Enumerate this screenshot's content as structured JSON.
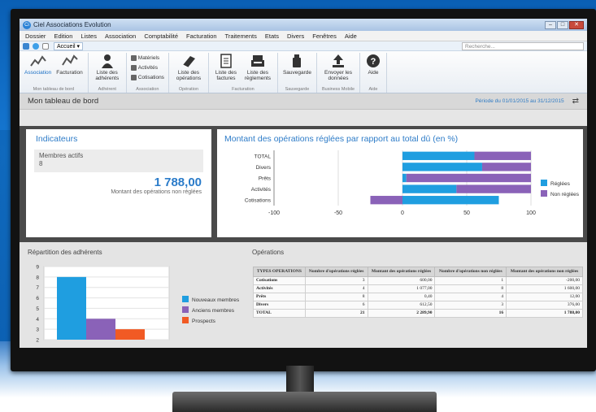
{
  "window": {
    "title": "Ciel Associations Evolution",
    "logo_text": "Ci"
  },
  "menu": [
    "Dossier",
    "Edition",
    "Listes",
    "Association",
    "Comptabilité",
    "Facturation",
    "Traitements",
    "Etats",
    "Divers",
    "Fenêtres",
    "Aide"
  ],
  "quickbar": {
    "tab_label": "Accueil",
    "search_placeholder": "Recherche..."
  },
  "ribbon": {
    "groups": [
      {
        "label": "Mon tableau de bord",
        "buttons": [
          "Association",
          "Facturation"
        ]
      },
      {
        "label": "Adhérent",
        "buttons": [
          "Liste des adhérents"
        ]
      },
      {
        "label": "Association",
        "small_items": [
          "Matériels",
          "Activités",
          "Cotisations"
        ]
      },
      {
        "label": "Opération",
        "buttons": [
          "Liste des opérations"
        ]
      },
      {
        "label": "Facturation",
        "buttons": [
          "Liste des factures",
          "Liste des règlements"
        ]
      },
      {
        "label": "Sauvegarde",
        "buttons": [
          "Sauvegarde"
        ]
      },
      {
        "label": "Business Mobile",
        "buttons": [
          "Envoyer les données"
        ]
      },
      {
        "label": "Aide",
        "buttons": [
          "Aide"
        ]
      }
    ]
  },
  "page": {
    "title": "Mon tableau de bord",
    "period": "Période du 01/01/2015 au 31/12/2015"
  },
  "indicators": {
    "title": "Indicateurs",
    "members_label": "Membres actifs",
    "members_value": "8",
    "amount": "1 788,00",
    "amount_label": "Montant des opérations non réglées"
  },
  "chart_data": [
    {
      "type": "bar",
      "orientation": "horizontal",
      "stacked": true,
      "title": "Montant des opérations réglées par rapport au total dû (en %)",
      "categories": [
        "TOTAL",
        "Divers",
        "Prêts",
        "Activités",
        "Cotisations"
      ],
      "series": [
        {
          "name": "Réglées",
          "color": "#1f9ee0",
          "values": [
            56,
            62,
            3,
            42,
            75
          ]
        },
        {
          "name": "Non réglées",
          "color": "#8a62b8",
          "values": [
            44,
            38,
            97,
            58,
            -25
          ]
        }
      ],
      "xlim": [
        -100,
        100
      ],
      "xticks": [
        "-100",
        "-50",
        "0",
        "50",
        "100"
      ],
      "legend": "right",
      "grid": true
    },
    {
      "type": "bar",
      "title": "Répartition des adhérents",
      "categories": [
        ""
      ],
      "series": [
        {
          "name": "Nouveaux membres",
          "color": "#1f9ee0",
          "values": [
            8
          ]
        },
        {
          "name": "Anciens membres",
          "color": "#8a62b8",
          "values": [
            4
          ]
        },
        {
          "name": "Prospects",
          "color": "#f15a24",
          "values": [
            3
          ]
        }
      ],
      "ylim": [
        2,
        9
      ],
      "yticks": [
        "2",
        "3",
        "4",
        "5",
        "6",
        "7",
        "8",
        "9"
      ],
      "legend": "right",
      "grid": true
    }
  ],
  "operations": {
    "title": "Opérations",
    "headers": [
      "TYPES OPERATIONS",
      "Nombre d'opérations réglées",
      "Montant des opérations réglées",
      "Nombre d'opérations non réglées",
      "Montant des opérations non réglées"
    ],
    "rows": [
      [
        "Cotisations",
        "3",
        "600,00",
        "1",
        "-200,00"
      ],
      [
        "Activités",
        "4",
        "1 077,00",
        "8",
        "1 600,00"
      ],
      [
        "Prêts",
        "8",
        "0,40",
        "4",
        "12,00"
      ],
      [
        "Divers",
        "6",
        "612,50",
        "3",
        "376,00"
      ],
      [
        "TOTAL",
        "21",
        "2 289,90",
        "16",
        "1 788,00"
      ]
    ]
  }
}
